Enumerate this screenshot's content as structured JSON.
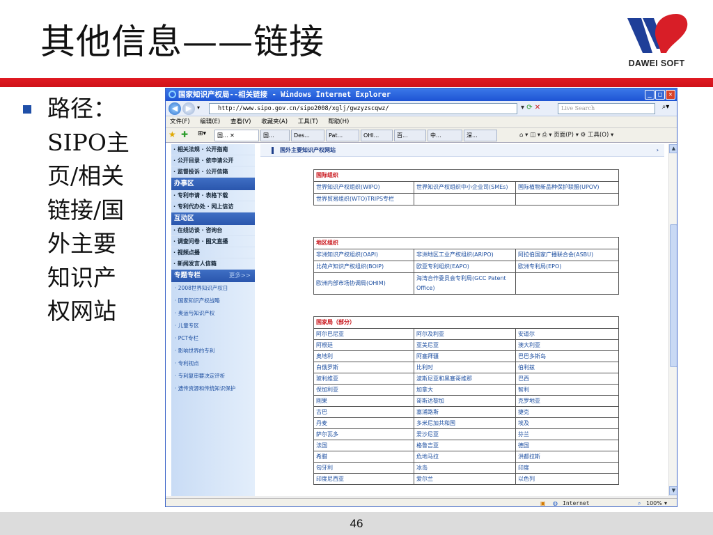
{
  "slide": {
    "title": "其他信息——链接",
    "logo_text": "DAWEI SOFT",
    "path_lines": [
      "路径：",
      "SIPO主",
      "页/相关",
      "链接/国",
      "外主要",
      "知识产",
      "权网站"
    ],
    "page_number": "46",
    "colors": {
      "accent_red": "#e01a22",
      "bullet_blue": "#1f4fa8",
      "logo_blue": "#1f3f98",
      "logo_red": "#d81e27"
    }
  },
  "ie": {
    "title": "国家知识产权局--相关链接 - Windows Internet Explorer",
    "address": "http://www.sipo.gov.cn/sipo2008/xglj/gwzyzscqwz/",
    "search_placeholder": "Live Search",
    "menu": [
      "文件(F)",
      "编辑(E)",
      "查看(V)",
      "收藏夹(A)",
      "工具(T)",
      "帮助(H)"
    ],
    "tabs": [
      "国...",
      "国...",
      "Des...",
      "Pat...",
      "OHI...",
      "百...",
      "中...",
      "深..."
    ],
    "toolbar_tools": "⌂ ▾  ◫ ▾  ⎙ ▾  页面(P) ▾  ⚙ 工具(O) ▾",
    "status_zone": "Internet",
    "status_zoom": "100%"
  },
  "sidebar": {
    "top_links": [
      [
        "相关法规",
        "公开指南"
      ],
      [
        "公开目录",
        "依申请公开"
      ],
      [
        "监督投诉",
        "公开信箱"
      ]
    ],
    "section_banshi": "办事区",
    "banshi_links": [
      [
        "专利申请",
        "表格下载"
      ],
      [
        "专利代办处",
        "网上信访"
      ]
    ],
    "section_hudong": "互动区",
    "hudong_links": [
      [
        "在线访谈",
        "咨询台"
      ],
      [
        "调查问卷",
        "图文直播"
      ],
      [
        "视频点播",
        ""
      ],
      [
        "新闻发言人信箱",
        ""
      ]
    ],
    "section_zhuanti": "专题专栏",
    "more": "更多>>",
    "zhuanti_items": [
      "2008世界知识产权日",
      "国家知识产权战略",
      "奥运与知识产权",
      "儿童专区",
      "PCT专栏",
      "影响世界的专利",
      "专利视点",
      "专利复审要决定评析",
      "遗传资源和传统知识保护"
    ]
  },
  "content": {
    "breadcrumb": "国外主要知识产权网站",
    "intl_header": "国际组织",
    "intl_rows": [
      [
        "世界知识产权组织(WIPO)",
        "世界知识产权组织中小企业司(SMEs)",
        "国际植物新品种保护联盟(UPOV)"
      ],
      [
        "世界贸易组织(WTO)TRIPS专栏",
        "",
        ""
      ]
    ],
    "region_header": "地区组织",
    "region_rows": [
      [
        "非洲知识产权组织(OAPI)",
        "非洲地区工业产权组织(ARIPO)",
        "阿拉伯国家广播联合会(ASBU)"
      ],
      [
        "比荷卢知识产权组织(BOIP)",
        "欧亚专利组织(EAPO)",
        "欧洲专利局(EPO)"
      ],
      [
        "欧洲内部市场协调局(OHIM)",
        "海湾合作委员会专利局(GCC Patent Office)",
        ""
      ]
    ],
    "country_header": "国家局（部分）",
    "country_rows": [
      [
        "阿尔巴尼亚",
        "阿尔及利亚",
        "安道尔"
      ],
      [
        "阿根廷",
        "亚美尼亚",
        "澳大利亚"
      ],
      [
        "奥地利",
        "阿塞拜疆",
        "巴巴多斯岛"
      ],
      [
        "白俄罗斯",
        "比利时",
        "伯利兹"
      ],
      [
        "玻利维亚",
        "波斯尼亚和黑塞哥维那",
        "巴西"
      ],
      [
        "保加利亚",
        "加拿大",
        "智利"
      ],
      [
        "刚果",
        "哥斯达黎加",
        "克罗地亚"
      ],
      [
        "古巴",
        "塞浦路斯",
        "捷克"
      ],
      [
        "丹麦",
        "多米尼加共和国",
        "埃及"
      ],
      [
        "萨尔瓦多",
        "爱沙尼亚",
        "芬兰"
      ],
      [
        "法国",
        "格鲁吉亚",
        "德国"
      ],
      [
        "希腊",
        "危地马拉",
        "洪都拉斯"
      ],
      [
        "匈牙利",
        "冰岛",
        "印度"
      ],
      [
        "印度尼西亚",
        "爱尔兰",
        "以色列"
      ]
    ]
  }
}
